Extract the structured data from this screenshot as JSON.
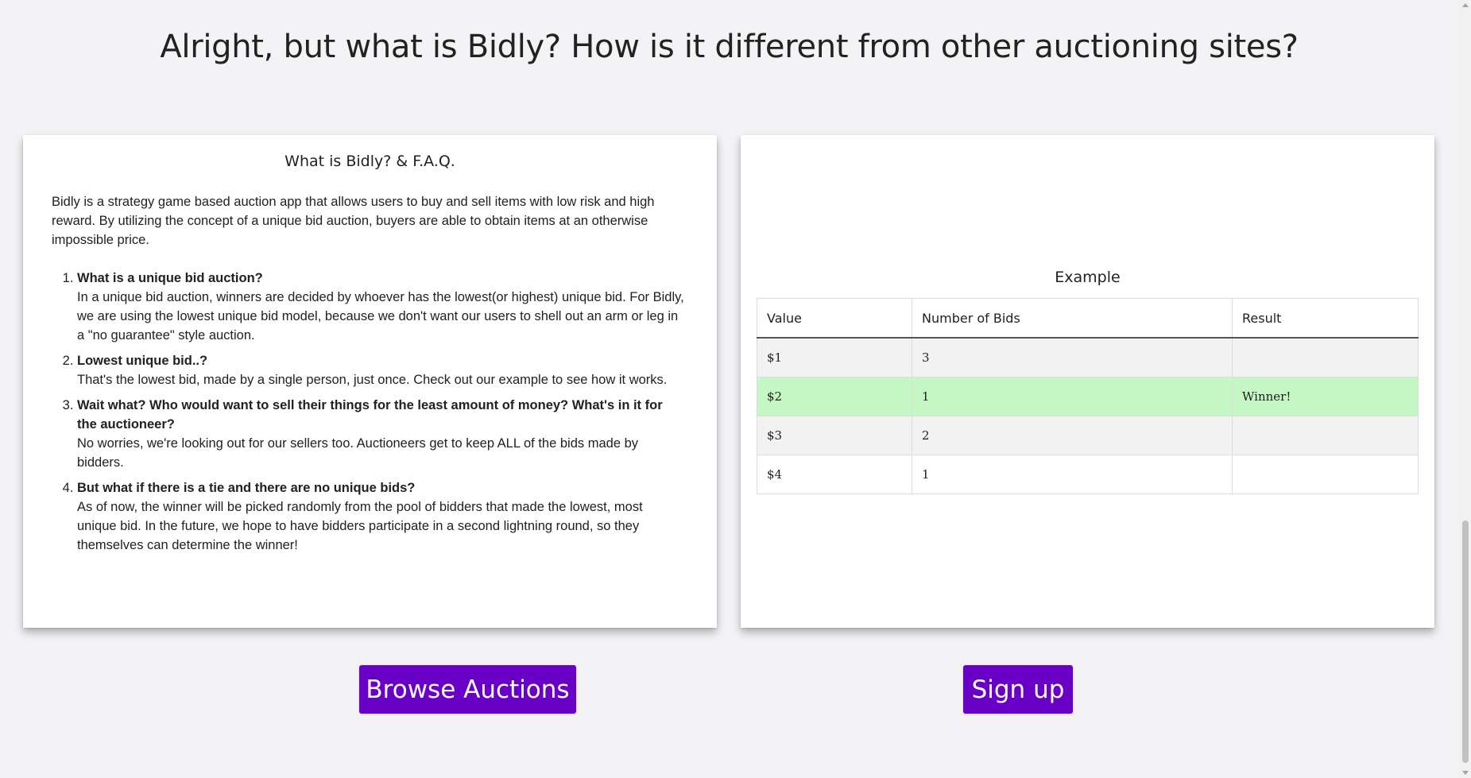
{
  "heading": "Alright, but what is Bidly? How is it different from other auctioning sites?",
  "faq_card": {
    "title": "What is Bidly? & F.A.Q.",
    "intro": "Bidly is a strategy game based auction app that allows users to buy and sell items with low risk and high reward. By utilizing the concept of a unique bid auction, buyers are able to obtain items at an otherwise impossible price.",
    "items": [
      {
        "question": "What is a unique bid auction?",
        "answer": "In a unique bid auction, winners are decided by whoever has the lowest(or highest) unique bid. For Bidly, we are using the lowest unique bid model, because we don't want our users to shell out an arm or leg in a \"no guarantee\" style auction."
      },
      {
        "question": "Lowest unique bid..?",
        "answer": "That's the lowest bid, made by a single person, just once. Check out our example to see how it works."
      },
      {
        "question": "Wait what? Who would want to sell their things for the least amount of money? What's in it for the auctioneer?",
        "answer": "No worries, we're looking out for our sellers too. Auctioneers get to keep ALL of the bids made by bidders."
      },
      {
        "question": "But what if there is a tie and there are no unique bids?",
        "answer": "As of now, the winner will be picked randomly from the pool of bidders that made the lowest, most unique bid. In the future, we hope to have bidders participate in a second lightning round, so they themselves can determine the winner!"
      }
    ]
  },
  "example_card": {
    "title": "Example",
    "columns": [
      "Value",
      "Number of Bids",
      "Result"
    ],
    "rows": [
      {
        "value": "$1",
        "bids": "3",
        "result": ""
      },
      {
        "value": "$2",
        "bids": "1",
        "result": "Winner!"
      },
      {
        "value": "$3",
        "bids": "2",
        "result": ""
      },
      {
        "value": "$4",
        "bids": "1",
        "result": ""
      }
    ],
    "winner_color": "#c5f7c5"
  },
  "buttons": {
    "browse": "Browse Auctions",
    "signup": "Sign up",
    "color": "#6a00c8"
  }
}
